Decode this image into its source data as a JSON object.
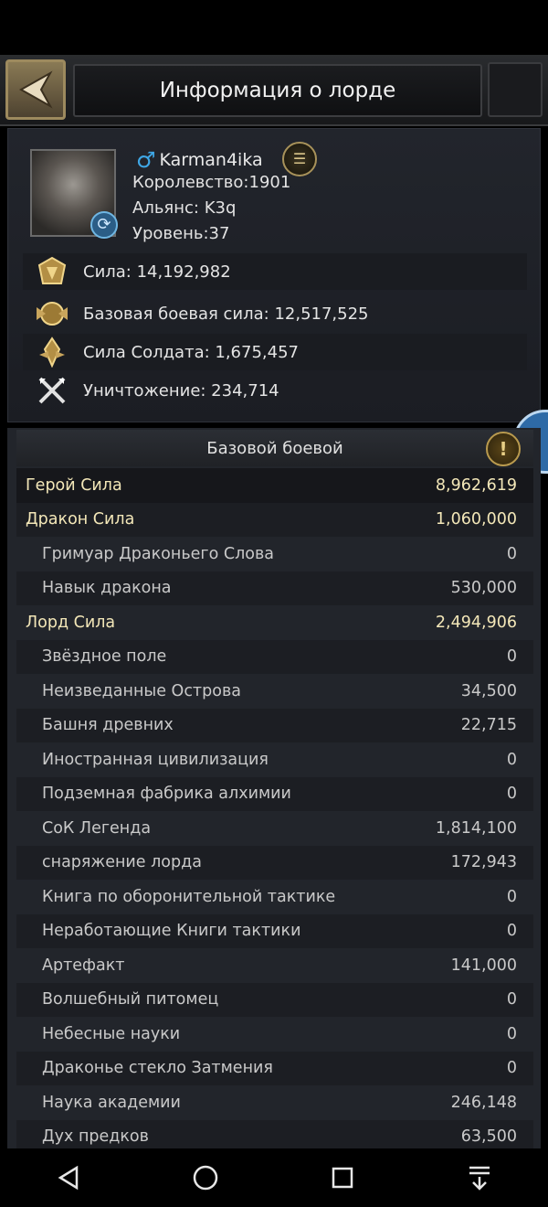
{
  "header": {
    "title": "Информация о лорде"
  },
  "profile": {
    "name": "Karman4ika",
    "kingdom": "Королевство:1901",
    "alliance": "Альянс: K3q",
    "level": "Уровень:37"
  },
  "stats": [
    {
      "label": "Сила: 14,192,982",
      "icon": "power-crest-icon"
    },
    {
      "label": "Базовая боевая сила: 12,517,525",
      "icon": "base-battle-crest-icon"
    },
    {
      "label": "Сила Солдата: 1,675,457",
      "icon": "soldier-crest-icon"
    },
    {
      "label": "Уничтожение: 234,714",
      "icon": "crossed-swords-icon"
    }
  ],
  "breakdown": {
    "title": "Базовой боевой",
    "rows": [
      {
        "label": "Герой Сила",
        "value": "8,962,619",
        "level": 1
      },
      {
        "label": "Дракон Сила",
        "value": "1,060,000",
        "level": 1
      },
      {
        "label": "Гримуар Драконьего Слова",
        "value": "0",
        "level": 2
      },
      {
        "label": "Навык дракона",
        "value": "530,000",
        "level": 2
      },
      {
        "label": "Лорд Сила",
        "value": "2,494,906",
        "level": 1
      },
      {
        "label": "Звёздное поле",
        "value": "0",
        "level": 2
      },
      {
        "label": "Неизведанные Острова",
        "value": "34,500",
        "level": 2
      },
      {
        "label": "Башня древних",
        "value": "22,715",
        "level": 2
      },
      {
        "label": "Иностранная цивилизация",
        "value": "0",
        "level": 2
      },
      {
        "label": "Подземная фабрика алхимии",
        "value": "0",
        "level": 2
      },
      {
        "label": "СоК Легенда",
        "value": "1,814,100",
        "level": 2
      },
      {
        "label": "снаряжение лорда",
        "value": "172,943",
        "level": 2
      },
      {
        "label": "Книга по оборонительной тактике",
        "value": "0",
        "level": 2
      },
      {
        "label": "Неработающие Книги тактики",
        "value": "0",
        "level": 2
      },
      {
        "label": "Артефакт",
        "value": "141,000",
        "level": 2
      },
      {
        "label": "Волшебный питомец",
        "value": "0",
        "level": 2
      },
      {
        "label": "Небесные науки",
        "value": "0",
        "level": 2
      },
      {
        "label": "Драконье стекло Затмения",
        "value": "0",
        "level": 2
      },
      {
        "label": "Наука академии",
        "value": "246,148",
        "level": 2
      },
      {
        "label": "Дух предков",
        "value": "63,500",
        "level": 2
      }
    ]
  },
  "colors": {
    "accent_gold": "#b99a4e",
    "highlight_text": "#f3e7b8",
    "male_blue": "#3fa7e6"
  }
}
